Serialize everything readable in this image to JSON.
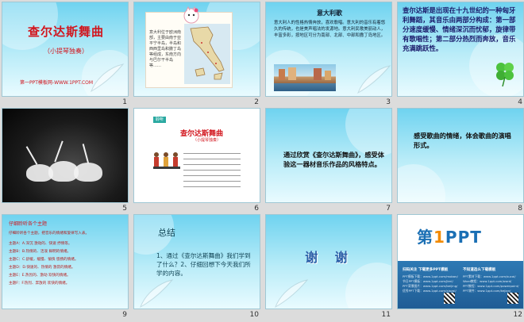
{
  "slides": [
    {
      "num": "1",
      "title": "查尔达斯舞曲",
      "subtitle": "（小提琴独奏）",
      "credit": "第一PPT模板网-WWW.1PPT.COM"
    },
    {
      "num": "2",
      "text": "意大利位于欧洲南部，主要由南于亚平宁半岛，半岛和西西里岛和撒丁岛等组成，东南方向与巴尔干半岛等……"
    },
    {
      "num": "3",
      "title": "意大利歌",
      "body": "意大利人的性格热情奔放，喜欢歌唱。意大利的音乐有着悠久的传统，也是美声唱法的发源地。意大利民歌美丽动人，丰富多彩，按地区可分为南部、北部、中部和撒丁岛地区。"
    },
    {
      "num": "4",
      "body": "查尔达斯是出现在十九世纪的一种匈牙利舞蹈，其音乐由两部分构成：第一部分速度缓慢、情绪深沉而忧郁，旋律带有歌唱性；第二部分热烈而奔放，音乐充满跳跃性。"
    },
    {
      "num": "5"
    },
    {
      "num": "6",
      "tag": "聆听",
      "title": "查尔达斯舞曲",
      "subtitle": "（小提琴独奏）"
    },
    {
      "num": "7",
      "body": "通过欣赏《查尔达斯舞曲》，感受体验这一器材音乐作品的风格特点。"
    },
    {
      "num": "8",
      "body": "感受歌曲的情绪，体会歌曲的演唱形式。"
    },
    {
      "num": "9",
      "heading": "仔细聆听各个主题",
      "intro": "仔细聆听各个主题，把音乐的情绪和旋律写入表。",
      "items": [
        "主题A：A.深沉 激动的、快速 抒情等。",
        "主题B：B.热情的、活泼 鲜明的情绪。",
        "主题C：C.舒缓，缓慢、愉快 悠扬的情绪。",
        "主题D：D.快速的、热情的 激昂的情绪。",
        "主题E：E.热烈的、激动 欢快的情绪。",
        "主题F：F.热烈、奔放的 欢快的情绪。"
      ]
    },
    {
      "num": "10",
      "title": "总结",
      "body": "1、通过《查尔达斯舞曲》我们学到了什么？2、仔细回想下今天我们所学的内容。"
    },
    {
      "num": "11",
      "text": "谢 谢"
    },
    {
      "num": "12",
      "logo_pre": "第",
      "logo_one": "1",
      "logo_post": "PPT",
      "col1_head": "扫码关注 下载更多PPT模板",
      "col2_head": "不知道选么下载模板",
      "col1_lines": [
        "PPT模板下载：www.1ppt.com/moban/",
        "节日PPT模板：www.1ppt.com/jieri/",
        "PPT背景图片：www.1ppt.com/beijing/",
        "优秀PPT下载：www.1ppt.com/xiazai/"
      ],
      "col2_lines": [
        "PPT素材下载：www.1ppt.com/sucai/",
        "Word教程：www.1ppt.com/word/",
        "PPT教程：www.1ppt.com/powerpoint/",
        "PPT课件：www.1ppt.com/kejian/"
      ]
    }
  ],
  "colors": {
    "title_red": "#d2151d",
    "navy": "#1b1b6b",
    "sky": "#6fd3f0"
  }
}
